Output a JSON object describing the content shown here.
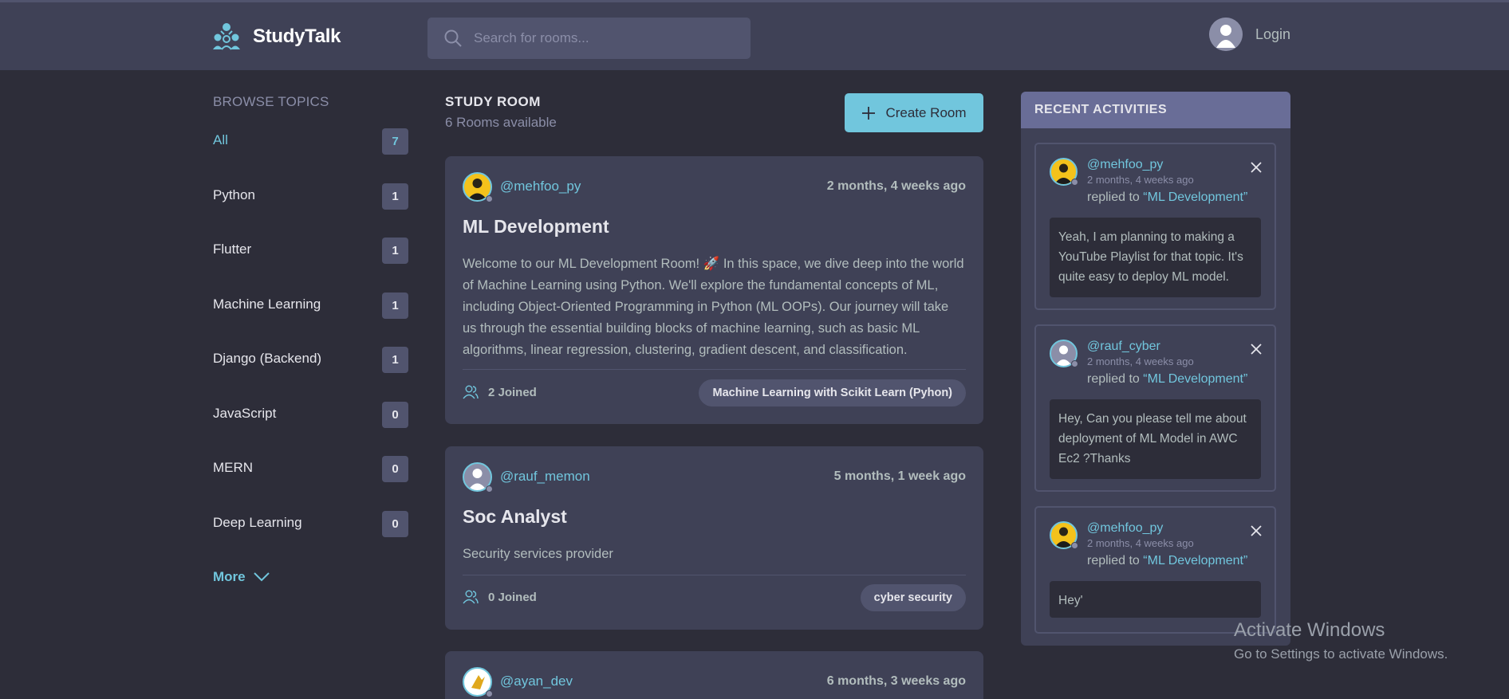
{
  "app": {
    "name": "StudyTalk"
  },
  "search": {
    "placeholder": "Search for rooms..."
  },
  "header": {
    "login_label": "Login"
  },
  "sidebar": {
    "title": "BROWSE TOPICS",
    "topics": [
      {
        "name": "All",
        "count": "7"
      },
      {
        "name": "Python",
        "count": "1"
      },
      {
        "name": "Flutter",
        "count": "1"
      },
      {
        "name": "Machine Learning",
        "count": "1"
      },
      {
        "name": "Django (Backend)",
        "count": "1"
      },
      {
        "name": "JavaScript",
        "count": "0"
      },
      {
        "name": "MERN",
        "count": "0"
      },
      {
        "name": "Deep Learning",
        "count": "0"
      }
    ],
    "more_label": "More"
  },
  "main": {
    "title": "STUDY ROOM",
    "subtitle": "6 Rooms available",
    "create_label": "Create Room",
    "rooms": [
      {
        "user": "@mehfoo_py",
        "time": "2 months, 4 weeks ago",
        "title": "ML Development",
        "description": "Welcome to our ML Development Room! 🚀 In this space, we dive deep into the world of Machine Learning using Python. We'll explore the fundamental concepts of ML, including Object-Oriented Programming in Python (ML OOPs). Our journey will take us through the essential building blocks of machine learning, such as basic ML algorithms, linear regression, clustering, gradient descent, and classification.",
        "joined": "2 Joined",
        "tag": "Machine Learning with Scikit Learn (Pyhon)"
      },
      {
        "user": "@rauf_memon",
        "time": "5 months, 1 week ago",
        "title": "Soc Analyst",
        "description": "Security services provider",
        "joined": "0 Joined",
        "tag": "cyber security"
      },
      {
        "user": "@ayan_dev",
        "time": "6 months, 3 weeks ago"
      }
    ]
  },
  "activities": {
    "title": "RECENT ACTIVITIES",
    "items": [
      {
        "user": "@mehfoo_py",
        "time": "2 months, 4 weeks ago",
        "reply_prefix": "replied to",
        "room": "“ML Development”",
        "message": "Yeah, I am planning to making a YouTube Playlist for that topic. It's quite easy to deploy ML model."
      },
      {
        "user": "@rauf_cyber",
        "time": "2 months, 4 weeks ago",
        "reply_prefix": "replied to",
        "room": "“ML Development”",
        "message": "Hey, Can you please tell me about deployment of ML Model in AWC Ec2 ?Thanks"
      },
      {
        "user": "@mehfoo_py",
        "time": "2 months, 4 weeks ago",
        "reply_prefix": "replied to",
        "room": "“ML Development”",
        "message": "Hey'"
      }
    ]
  },
  "watermark": {
    "title": "Activate Windows",
    "subtitle": "Go to Settings to activate Windows."
  },
  "colors": {
    "background": "#2d2d39",
    "surface": "#3f4156",
    "accent": "#71c6dd",
    "muted": "#8b8ea8",
    "header_strip": "#696d97"
  }
}
